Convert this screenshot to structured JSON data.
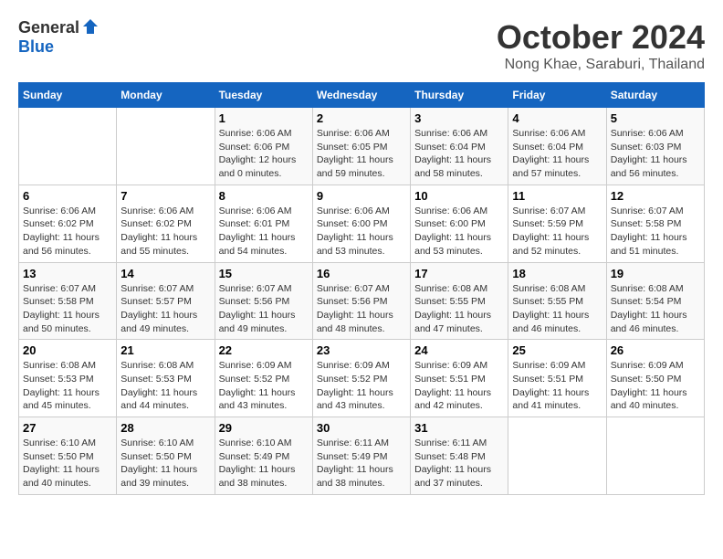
{
  "logo": {
    "general": "General",
    "blue": "Blue"
  },
  "title": "October 2024",
  "location": "Nong Khae, Saraburi, Thailand",
  "weekdays": [
    "Sunday",
    "Monday",
    "Tuesday",
    "Wednesday",
    "Thursday",
    "Friday",
    "Saturday"
  ],
  "weeks": [
    [
      {
        "day": "",
        "sunrise": "",
        "sunset": "",
        "daylight": ""
      },
      {
        "day": "",
        "sunrise": "",
        "sunset": "",
        "daylight": ""
      },
      {
        "day": "1",
        "sunrise": "Sunrise: 6:06 AM",
        "sunset": "Sunset: 6:06 PM",
        "daylight": "Daylight: 12 hours and 0 minutes."
      },
      {
        "day": "2",
        "sunrise": "Sunrise: 6:06 AM",
        "sunset": "Sunset: 6:05 PM",
        "daylight": "Daylight: 11 hours and 59 minutes."
      },
      {
        "day": "3",
        "sunrise": "Sunrise: 6:06 AM",
        "sunset": "Sunset: 6:04 PM",
        "daylight": "Daylight: 11 hours and 58 minutes."
      },
      {
        "day": "4",
        "sunrise": "Sunrise: 6:06 AM",
        "sunset": "Sunset: 6:04 PM",
        "daylight": "Daylight: 11 hours and 57 minutes."
      },
      {
        "day": "5",
        "sunrise": "Sunrise: 6:06 AM",
        "sunset": "Sunset: 6:03 PM",
        "daylight": "Daylight: 11 hours and 56 minutes."
      }
    ],
    [
      {
        "day": "6",
        "sunrise": "Sunrise: 6:06 AM",
        "sunset": "Sunset: 6:02 PM",
        "daylight": "Daylight: 11 hours and 56 minutes."
      },
      {
        "day": "7",
        "sunrise": "Sunrise: 6:06 AM",
        "sunset": "Sunset: 6:02 PM",
        "daylight": "Daylight: 11 hours and 55 minutes."
      },
      {
        "day": "8",
        "sunrise": "Sunrise: 6:06 AM",
        "sunset": "Sunset: 6:01 PM",
        "daylight": "Daylight: 11 hours and 54 minutes."
      },
      {
        "day": "9",
        "sunrise": "Sunrise: 6:06 AM",
        "sunset": "Sunset: 6:00 PM",
        "daylight": "Daylight: 11 hours and 53 minutes."
      },
      {
        "day": "10",
        "sunrise": "Sunrise: 6:06 AM",
        "sunset": "Sunset: 6:00 PM",
        "daylight": "Daylight: 11 hours and 53 minutes."
      },
      {
        "day": "11",
        "sunrise": "Sunrise: 6:07 AM",
        "sunset": "Sunset: 5:59 PM",
        "daylight": "Daylight: 11 hours and 52 minutes."
      },
      {
        "day": "12",
        "sunrise": "Sunrise: 6:07 AM",
        "sunset": "Sunset: 5:58 PM",
        "daylight": "Daylight: 11 hours and 51 minutes."
      }
    ],
    [
      {
        "day": "13",
        "sunrise": "Sunrise: 6:07 AM",
        "sunset": "Sunset: 5:58 PM",
        "daylight": "Daylight: 11 hours and 50 minutes."
      },
      {
        "day": "14",
        "sunrise": "Sunrise: 6:07 AM",
        "sunset": "Sunset: 5:57 PM",
        "daylight": "Daylight: 11 hours and 49 minutes."
      },
      {
        "day": "15",
        "sunrise": "Sunrise: 6:07 AM",
        "sunset": "Sunset: 5:56 PM",
        "daylight": "Daylight: 11 hours and 49 minutes."
      },
      {
        "day": "16",
        "sunrise": "Sunrise: 6:07 AM",
        "sunset": "Sunset: 5:56 PM",
        "daylight": "Daylight: 11 hours and 48 minutes."
      },
      {
        "day": "17",
        "sunrise": "Sunrise: 6:08 AM",
        "sunset": "Sunset: 5:55 PM",
        "daylight": "Daylight: 11 hours and 47 minutes."
      },
      {
        "day": "18",
        "sunrise": "Sunrise: 6:08 AM",
        "sunset": "Sunset: 5:55 PM",
        "daylight": "Daylight: 11 hours and 46 minutes."
      },
      {
        "day": "19",
        "sunrise": "Sunrise: 6:08 AM",
        "sunset": "Sunset: 5:54 PM",
        "daylight": "Daylight: 11 hours and 46 minutes."
      }
    ],
    [
      {
        "day": "20",
        "sunrise": "Sunrise: 6:08 AM",
        "sunset": "Sunset: 5:53 PM",
        "daylight": "Daylight: 11 hours and 45 minutes."
      },
      {
        "day": "21",
        "sunrise": "Sunrise: 6:08 AM",
        "sunset": "Sunset: 5:53 PM",
        "daylight": "Daylight: 11 hours and 44 minutes."
      },
      {
        "day": "22",
        "sunrise": "Sunrise: 6:09 AM",
        "sunset": "Sunset: 5:52 PM",
        "daylight": "Daylight: 11 hours and 43 minutes."
      },
      {
        "day": "23",
        "sunrise": "Sunrise: 6:09 AM",
        "sunset": "Sunset: 5:52 PM",
        "daylight": "Daylight: 11 hours and 43 minutes."
      },
      {
        "day": "24",
        "sunrise": "Sunrise: 6:09 AM",
        "sunset": "Sunset: 5:51 PM",
        "daylight": "Daylight: 11 hours and 42 minutes."
      },
      {
        "day": "25",
        "sunrise": "Sunrise: 6:09 AM",
        "sunset": "Sunset: 5:51 PM",
        "daylight": "Daylight: 11 hours and 41 minutes."
      },
      {
        "day": "26",
        "sunrise": "Sunrise: 6:09 AM",
        "sunset": "Sunset: 5:50 PM",
        "daylight": "Daylight: 11 hours and 40 minutes."
      }
    ],
    [
      {
        "day": "27",
        "sunrise": "Sunrise: 6:10 AM",
        "sunset": "Sunset: 5:50 PM",
        "daylight": "Daylight: 11 hours and 40 minutes."
      },
      {
        "day": "28",
        "sunrise": "Sunrise: 6:10 AM",
        "sunset": "Sunset: 5:50 PM",
        "daylight": "Daylight: 11 hours and 39 minutes."
      },
      {
        "day": "29",
        "sunrise": "Sunrise: 6:10 AM",
        "sunset": "Sunset: 5:49 PM",
        "daylight": "Daylight: 11 hours and 38 minutes."
      },
      {
        "day": "30",
        "sunrise": "Sunrise: 6:11 AM",
        "sunset": "Sunset: 5:49 PM",
        "daylight": "Daylight: 11 hours and 38 minutes."
      },
      {
        "day": "31",
        "sunrise": "Sunrise: 6:11 AM",
        "sunset": "Sunset: 5:48 PM",
        "daylight": "Daylight: 11 hours and 37 minutes."
      },
      {
        "day": "",
        "sunrise": "",
        "sunset": "",
        "daylight": ""
      },
      {
        "day": "",
        "sunrise": "",
        "sunset": "",
        "daylight": ""
      }
    ]
  ]
}
